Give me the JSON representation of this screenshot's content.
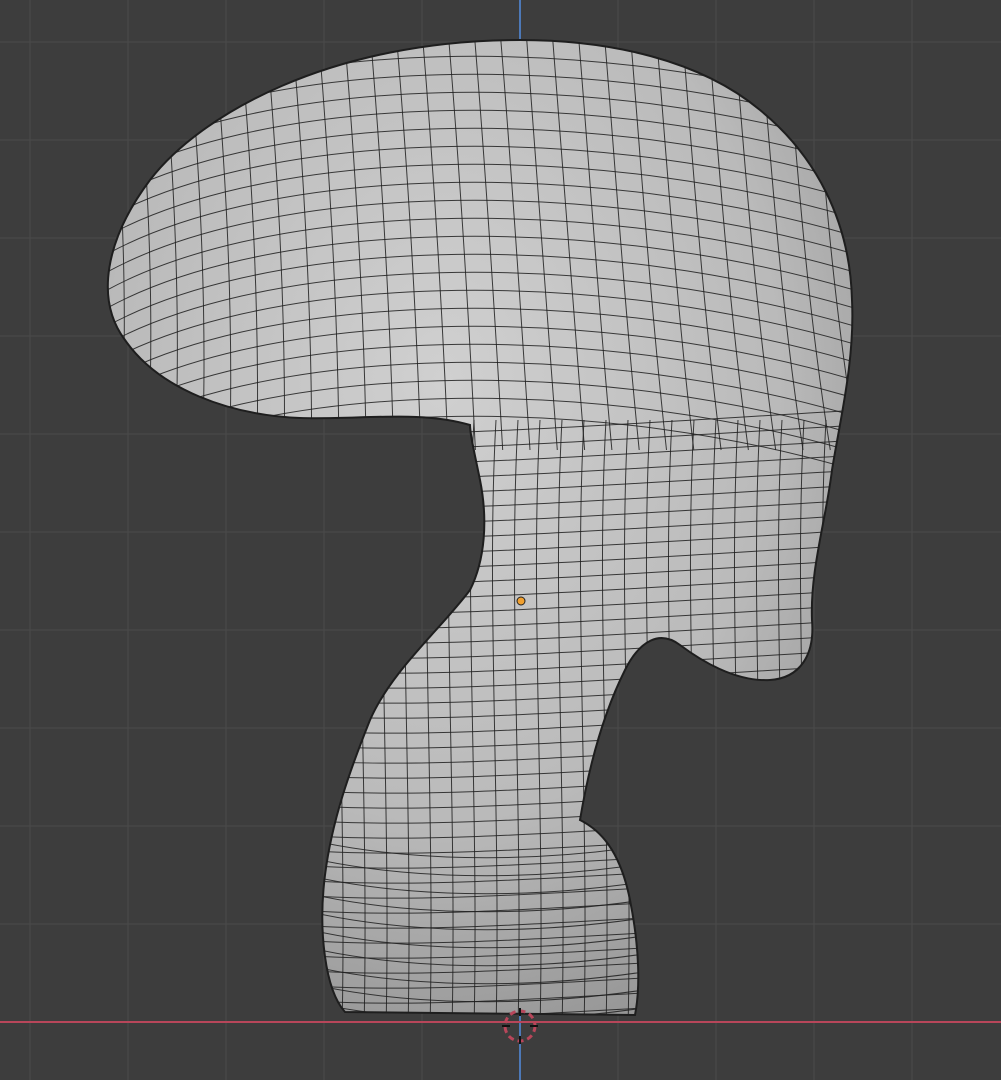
{
  "viewport": {
    "background_color": "#3d3d3d",
    "grid_color": "#4a4a4a",
    "x_axis_color": "#b8465a",
    "z_axis_color": "#4d79b8",
    "mesh_fill_color": "#bdbdbd",
    "mesh_wire_color": "#1e1e1e",
    "origin_color": "#f0a030",
    "cursor_icon": "3d-cursor-icon",
    "origin_icon": "object-origin-icon"
  }
}
